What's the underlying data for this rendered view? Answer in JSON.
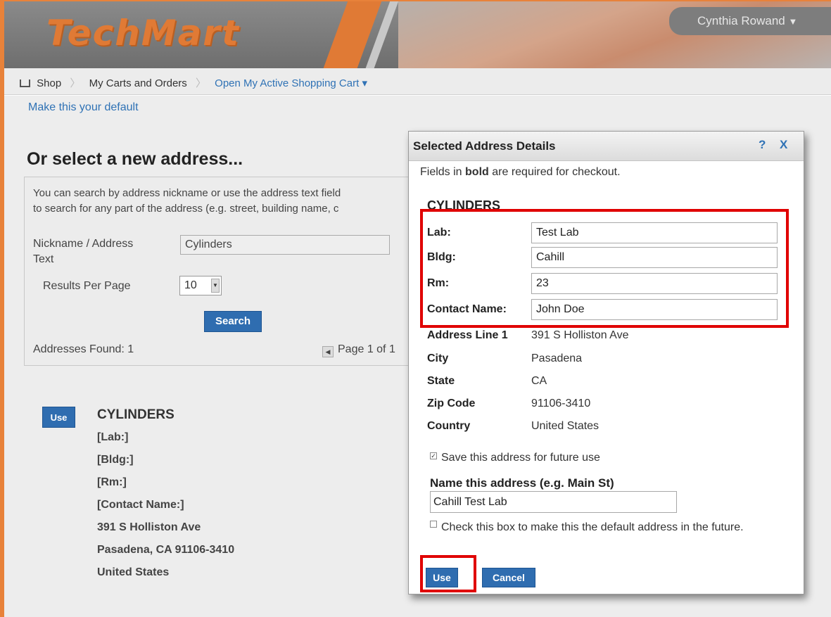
{
  "header": {
    "logo_text": "TechMart",
    "user_name": "Cynthia Rowand",
    "user_caret": "▼"
  },
  "breadcrumb": {
    "items": [
      "Shop",
      "My Carts and Orders",
      "Open My Active Shopping Cart"
    ],
    "active_caret": "▾"
  },
  "page": {
    "default_link": "Make this your default",
    "section_title": "Or select a new address...",
    "search_help": [
      "You can search by address nickname or use the address text field",
      "to search for any part of the address (e.g. street, building name, c"
    ],
    "nickname_label_1": "Nickname / Address",
    "nickname_label_2": "Text",
    "nickname_value": "Cylinders",
    "per_page_label": "Results Per Page",
    "per_page_value": "10",
    "search_button": "Search",
    "addresses_found": "Addresses Found: 1",
    "pager_text": "Page 1 of 1"
  },
  "result": {
    "use_button": "Use",
    "lines": [
      "CYLINDERS",
      "[Lab:]",
      "[Bldg:]",
      "[Rm:]",
      "[Contact Name:]",
      "391 S Holliston Ave",
      "Pasadena, CA 91106-3410",
      "United States"
    ]
  },
  "modal": {
    "title": "Selected Address Details",
    "help": "?",
    "close": "X",
    "note_pre": "Fields in ",
    "note_bold": "bold",
    "note_post": " are required for checkout.",
    "address_name": "CYLINDERS",
    "inputs": [
      {
        "label": "Lab:",
        "value": "Test Lab"
      },
      {
        "label": "Bldg:",
        "value": "Cahill"
      },
      {
        "label": "Rm:",
        "value": "23"
      },
      {
        "label": "Contact Name:",
        "value": "John Doe"
      }
    ],
    "details": [
      {
        "label": "Address Line 1",
        "value": "391 S Holliston Ave"
      },
      {
        "label": "City",
        "value": "Pasadena"
      },
      {
        "label": "State",
        "value": "CA"
      },
      {
        "label": "Zip Code",
        "value": "91106-3410"
      },
      {
        "label": "Country",
        "value": "United States"
      }
    ],
    "save_label": "Save this address for future use",
    "save_checked": true,
    "name_label": "Name this address (e.g. Main St)",
    "name_value": "Cahill Test Lab",
    "default_label": "Check this box to make this the default address in the future.",
    "default_checked": false,
    "use_button": "Use",
    "cancel_button": "Cancel"
  },
  "colors": {
    "accent_orange": "#e07a35",
    "link_blue": "#2f72b5",
    "button_blue": "#2f6db0",
    "highlight_red": "#e00000"
  }
}
